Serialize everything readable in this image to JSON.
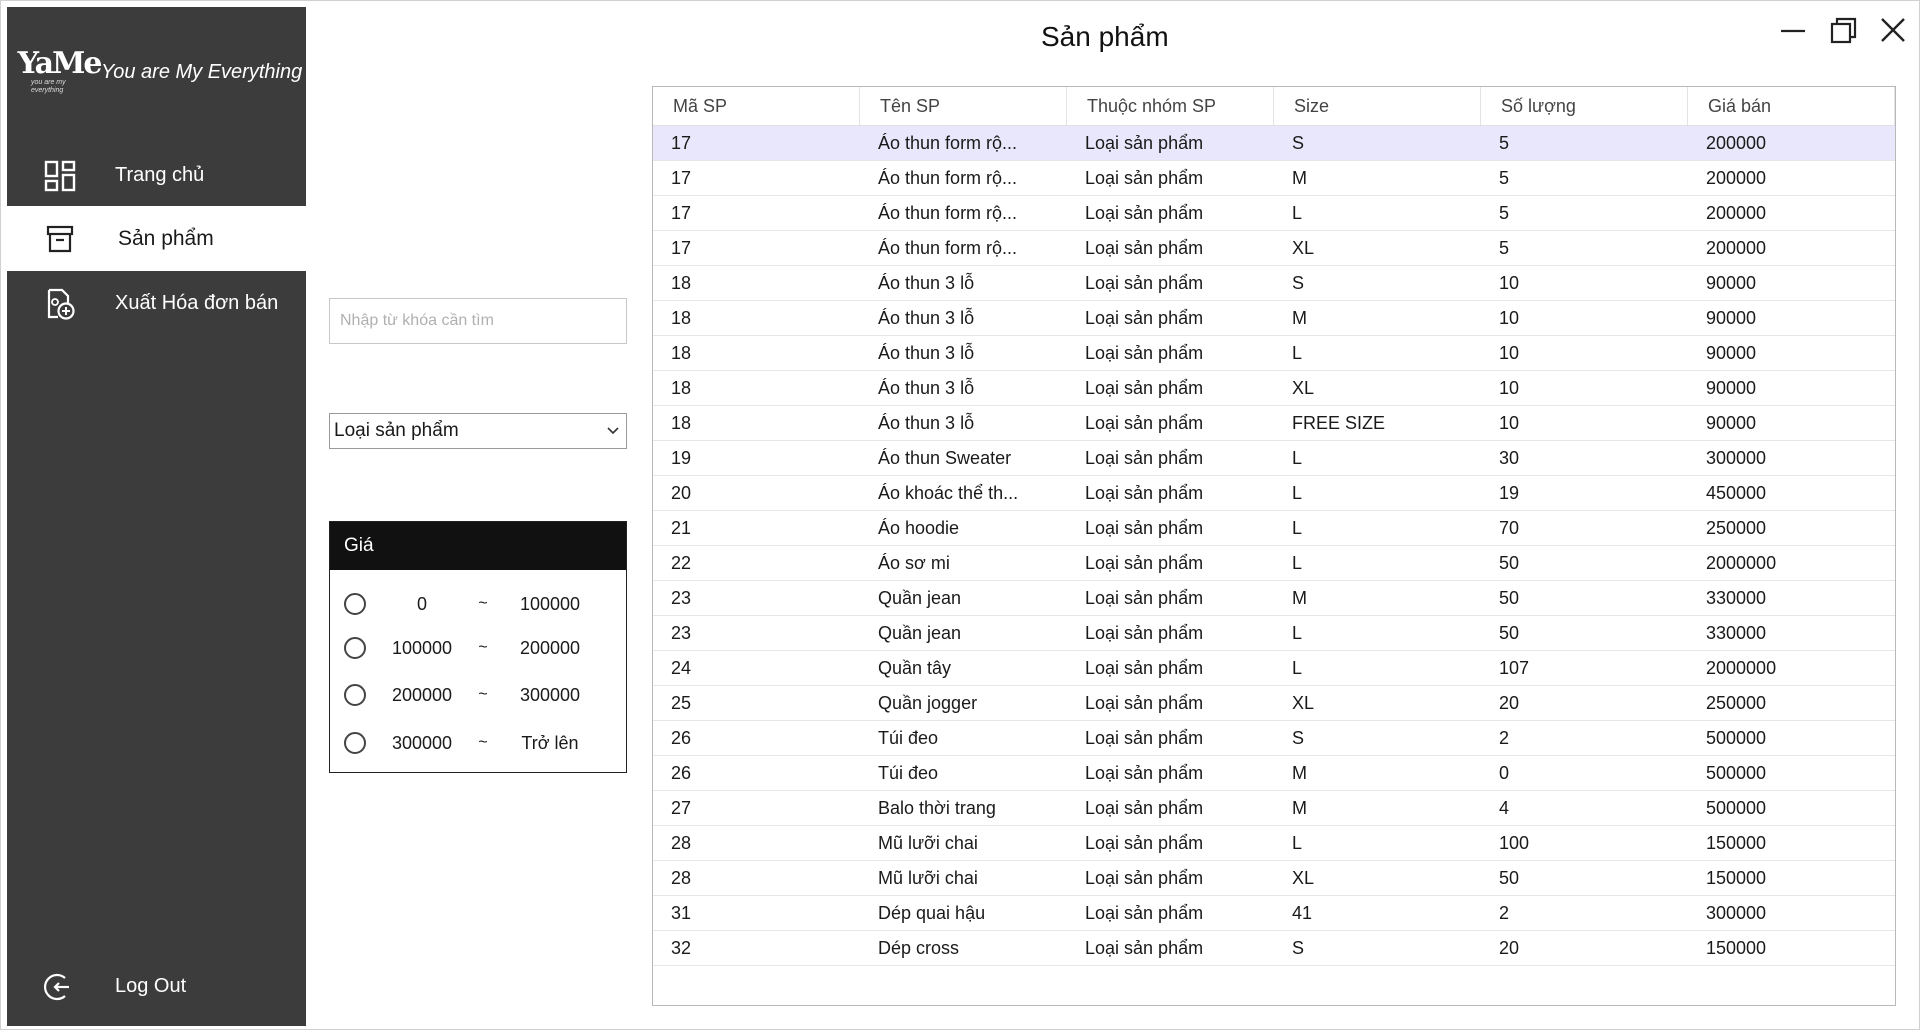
{
  "app": {
    "logo_text": "YaMe",
    "logo_sub": "you are my everything",
    "tagline": "You are My Everything",
    "page_title": "Sản phẩm"
  },
  "sidebar": {
    "items": [
      {
        "label": "Trang chủ",
        "icon": "dashboard-icon"
      },
      {
        "label": "Sản phẩm",
        "icon": "box-icon",
        "active": true
      },
      {
        "label": "Xuất Hóa đơn bán",
        "icon": "invoice-add-icon"
      }
    ],
    "logout": {
      "label": "Log Out",
      "icon": "logout-icon"
    }
  },
  "filters": {
    "search_placeholder": "Nhập từ khóa cần tìm",
    "category_selected": "Loại sản phẩm",
    "price_title": "Giá",
    "price_ranges": [
      {
        "from": "0",
        "sep": "~",
        "to": "100000"
      },
      {
        "from": "100000",
        "sep": "~",
        "to": "200000"
      },
      {
        "from": "200000",
        "sep": "~",
        "to": "300000"
      },
      {
        "from": "300000",
        "sep": "~",
        "to": "Trở lên"
      }
    ]
  },
  "table": {
    "columns": [
      "Mã SP",
      "Tên SP",
      "Thuộc nhóm SP",
      "Size",
      "Số lượng",
      "Giá bán"
    ],
    "rows": [
      [
        "17",
        "Áo thun form rộ...",
        "Loại sản phẩm",
        "S",
        "5",
        "200000"
      ],
      [
        "17",
        "Áo thun form rộ...",
        "Loại sản phẩm",
        "M",
        "5",
        "200000"
      ],
      [
        "17",
        "Áo thun form rộ...",
        "Loại sản phẩm",
        "L",
        "5",
        "200000"
      ],
      [
        "17",
        "Áo thun form rộ...",
        "Loại sản phẩm",
        "XL",
        "5",
        "200000"
      ],
      [
        "18",
        "Áo thun 3 lỗ",
        "Loại sản phẩm",
        "S",
        "10",
        "90000"
      ],
      [
        "18",
        "Áo thun 3 lỗ",
        "Loại sản phẩm",
        "M",
        "10",
        "90000"
      ],
      [
        "18",
        "Áo thun 3 lỗ",
        "Loại sản phẩm",
        "L",
        "10",
        "90000"
      ],
      [
        "18",
        "Áo thun 3 lỗ",
        "Loại sản phẩm",
        "XL",
        "10",
        "90000"
      ],
      [
        "18",
        "Áo thun 3 lỗ",
        "Loại sản phẩm",
        "FREE SIZE",
        "10",
        "90000"
      ],
      [
        "19",
        "Áo thun Sweater",
        "Loại sản phẩm",
        "L",
        "30",
        "300000"
      ],
      [
        "20",
        "Áo khoác thể th...",
        "Loại sản phẩm",
        "L",
        "19",
        "450000"
      ],
      [
        "21",
        "Áo hoodie",
        "Loại sản phẩm",
        "L",
        "70",
        "250000"
      ],
      [
        "22",
        "Áo sơ mi",
        "Loại sản phẩm",
        "L",
        "50",
        "2000000"
      ],
      [
        "23",
        "Quần jean",
        "Loại sản phẩm",
        "M",
        "50",
        "330000"
      ],
      [
        "23",
        "Quần jean",
        "Loại sản phẩm",
        "L",
        "50",
        "330000"
      ],
      [
        "24",
        "Quần tây",
        "Loại sản phẩm",
        "L",
        "107",
        "2000000"
      ],
      [
        "25",
        "Quần jogger",
        "Loại sản phẩm",
        "XL",
        "20",
        "250000"
      ],
      [
        "26",
        "Túi đeo",
        "Loại sản phẩm",
        "S",
        "2",
        "500000"
      ],
      [
        "26",
        "Túi đeo",
        "Loại sản phẩm",
        "M",
        "0",
        "500000"
      ],
      [
        "27",
        "Balo thời trang",
        "Loại sản phẩm",
        "M",
        "4",
        "500000"
      ],
      [
        "28",
        "Mũ lưỡi chai",
        "Loại sản phẩm",
        "L",
        "100",
        "150000"
      ],
      [
        "28",
        "Mũ lưỡi chai",
        "Loại sản phẩm",
        "XL",
        "50",
        "150000"
      ],
      [
        "31",
        "Dép quai hậu",
        "Loại sản phẩm",
        "41",
        "2",
        "300000"
      ],
      [
        "32",
        "Dép cross",
        "Loại sản phẩm",
        "S",
        "20",
        "150000"
      ]
    ]
  },
  "colors": {
    "sidebar_bg": "#3c3c3c",
    "selected_row": "#e9e7fb",
    "price_header_bg": "#111111"
  }
}
